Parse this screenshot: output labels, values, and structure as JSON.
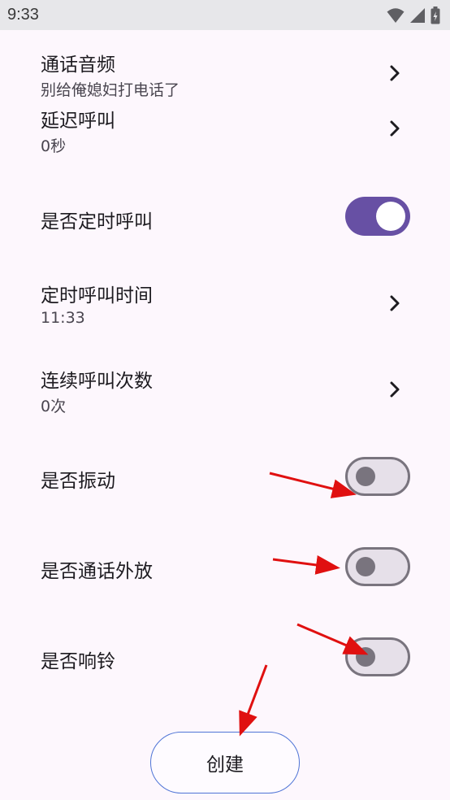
{
  "status_bar": {
    "time": "9:33"
  },
  "settings": [
    {
      "key": "audio",
      "title": "通话音频",
      "subtitle": "别给俺媳妇打电话了",
      "control": "chevron"
    },
    {
      "key": "delay",
      "title": "延迟呼叫",
      "subtitle": "0秒",
      "control": "chevron"
    },
    {
      "key": "scheduled",
      "title": "是否定时呼叫",
      "control": "toggle",
      "on": true
    },
    {
      "key": "scheduled-time",
      "title": "定时呼叫时间",
      "subtitle": "11:33",
      "control": "chevron"
    },
    {
      "key": "repeat-count",
      "title": "连续呼叫次数",
      "subtitle": "0次",
      "control": "chevron"
    },
    {
      "key": "vibrate",
      "title": "是否振动",
      "control": "toggle",
      "on": false
    },
    {
      "key": "speaker",
      "title": "是否通话外放",
      "control": "toggle",
      "on": false
    },
    {
      "key": "ring",
      "title": "是否响铃",
      "control": "toggle",
      "on": false
    }
  ],
  "create_button": {
    "label": "创建"
  },
  "colors": {
    "accent": "#6750a4",
    "annotation_arrow": "#e01010",
    "button_border": "#4f74d6"
  }
}
